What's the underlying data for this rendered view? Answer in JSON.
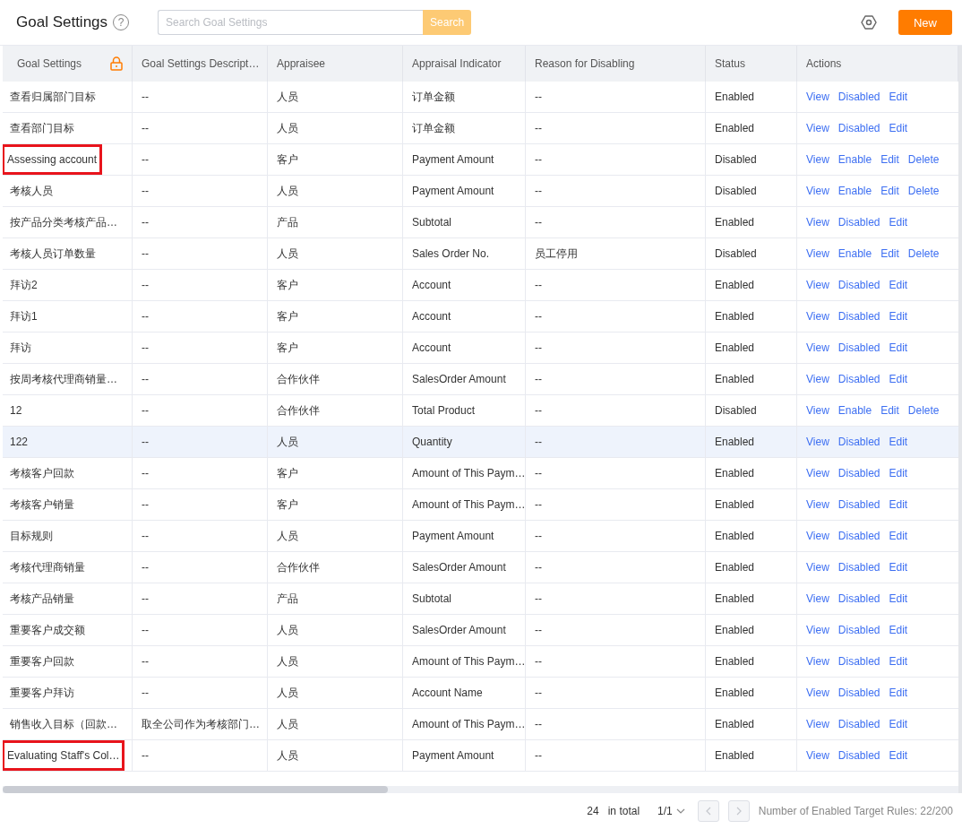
{
  "header": {
    "title": "Goal Settings",
    "help": "?",
    "search": {
      "placeholder": "Search Goal Settings",
      "button": "Search"
    },
    "new_button": "New"
  },
  "table": {
    "columns": [
      {
        "label": "Goal Settings",
        "locked": true
      },
      {
        "label": "Goal Settings Descript…"
      },
      {
        "label": "Appraisee"
      },
      {
        "label": "Appraisal Indicator"
      },
      {
        "label": "Reason for Disabling"
      },
      {
        "label": "Status"
      },
      {
        "label": "Actions"
      }
    ],
    "rows": [
      {
        "cells": [
          "查看归属部门目标",
          "--",
          "人员",
          "订单金额",
          "--",
          "Enabled"
        ],
        "actions": [
          "View",
          "Disabled",
          "Edit"
        ],
        "highlighted": false,
        "hovered": false
      },
      {
        "cells": [
          "查看部门目标",
          "--",
          "人员",
          "订单金额",
          "--",
          "Enabled"
        ],
        "actions": [
          "View",
          "Disabled",
          "Edit"
        ],
        "highlighted": false,
        "hovered": false
      },
      {
        "cells": [
          "Assessing account",
          "--",
          "客户",
          "Payment Amount",
          "--",
          "Disabled"
        ],
        "actions": [
          "View",
          "Enable",
          "Edit",
          "Delete"
        ],
        "highlighted": true,
        "hovered": false
      },
      {
        "cells": [
          "考核人员",
          "--",
          "人员",
          "Payment Amount",
          "--",
          "Disabled"
        ],
        "actions": [
          "View",
          "Enable",
          "Edit",
          "Delete"
        ],
        "highlighted": false,
        "hovered": false
      },
      {
        "cells": [
          "按产品分类考核产品…",
          "--",
          "产品",
          "Subtotal",
          "--",
          "Enabled"
        ],
        "actions": [
          "View",
          "Disabled",
          "Edit"
        ],
        "highlighted": false,
        "hovered": false
      },
      {
        "cells": [
          "考核人员订单数量",
          "--",
          "人员",
          "Sales Order No.",
          "员工停用",
          "Disabled"
        ],
        "actions": [
          "View",
          "Enable",
          "Edit",
          "Delete"
        ],
        "highlighted": false,
        "hovered": false
      },
      {
        "cells": [
          "拜访2",
          "--",
          "客户",
          "Account",
          "--",
          "Enabled"
        ],
        "actions": [
          "View",
          "Disabled",
          "Edit"
        ],
        "highlighted": false,
        "hovered": false
      },
      {
        "cells": [
          "拜访1",
          "--",
          "客户",
          "Account",
          "--",
          "Enabled"
        ],
        "actions": [
          "View",
          "Disabled",
          "Edit"
        ],
        "highlighted": false,
        "hovered": false
      },
      {
        "cells": [
          "拜访",
          "--",
          "客户",
          "Account",
          "--",
          "Enabled"
        ],
        "actions": [
          "View",
          "Disabled",
          "Edit"
        ],
        "highlighted": false,
        "hovered": false
      },
      {
        "cells": [
          "按周考核代理商销量…",
          "--",
          "合作伙伴",
          "SalesOrder Amount",
          "--",
          "Enabled"
        ],
        "actions": [
          "View",
          "Disabled",
          "Edit"
        ],
        "highlighted": false,
        "hovered": false
      },
      {
        "cells": [
          "12",
          "--",
          "合作伙伴",
          "Total Product",
          "--",
          "Disabled"
        ],
        "actions": [
          "View",
          "Enable",
          "Edit",
          "Delete"
        ],
        "highlighted": false,
        "hovered": false
      },
      {
        "cells": [
          "122",
          "--",
          "人员",
          "Quantity",
          "--",
          "Enabled"
        ],
        "actions": [
          "View",
          "Disabled",
          "Edit"
        ],
        "highlighted": false,
        "hovered": true
      },
      {
        "cells": [
          "考核客户回款",
          "--",
          "客户",
          "Amount of This Paym…",
          "--",
          "Enabled"
        ],
        "actions": [
          "View",
          "Disabled",
          "Edit"
        ],
        "highlighted": false,
        "hovered": false
      },
      {
        "cells": [
          "考核客户销量",
          "--",
          "客户",
          "Amount of This Paym…",
          "--",
          "Enabled"
        ],
        "actions": [
          "View",
          "Disabled",
          "Edit"
        ],
        "highlighted": false,
        "hovered": false
      },
      {
        "cells": [
          "目标规则",
          "--",
          "人员",
          "Payment Amount",
          "--",
          "Enabled"
        ],
        "actions": [
          "View",
          "Disabled",
          "Edit"
        ],
        "highlighted": false,
        "hovered": false
      },
      {
        "cells": [
          "考核代理商销量",
          "--",
          "合作伙伴",
          "SalesOrder Amount",
          "--",
          "Enabled"
        ],
        "actions": [
          "View",
          "Disabled",
          "Edit"
        ],
        "highlighted": false,
        "hovered": false
      },
      {
        "cells": [
          "考核产品销量",
          "--",
          "产品",
          "Subtotal",
          "--",
          "Enabled"
        ],
        "actions": [
          "View",
          "Disabled",
          "Edit"
        ],
        "highlighted": false,
        "hovered": false
      },
      {
        "cells": [
          "重要客户成交额",
          "--",
          "人员",
          "SalesOrder Amount",
          "--",
          "Enabled"
        ],
        "actions": [
          "View",
          "Disabled",
          "Edit"
        ],
        "highlighted": false,
        "hovered": false
      },
      {
        "cells": [
          "重要客户回款",
          "--",
          "人员",
          "Amount of This Paym…",
          "--",
          "Enabled"
        ],
        "actions": [
          "View",
          "Disabled",
          "Edit"
        ],
        "highlighted": false,
        "hovered": false
      },
      {
        "cells": [
          "重要客户拜访",
          "--",
          "人员",
          "Account Name",
          "--",
          "Enabled"
        ],
        "actions": [
          "View",
          "Disabled",
          "Edit"
        ],
        "highlighted": false,
        "hovered": false
      },
      {
        "cells": [
          "销售收入目标（回款…",
          "取全公司作为考核部门…",
          "人员",
          "Amount of This Paym…",
          "--",
          "Enabled"
        ],
        "actions": [
          "View",
          "Disabled",
          "Edit"
        ],
        "highlighted": false,
        "hovered": false
      },
      {
        "cells": [
          "Evaluating Staff's Col…",
          "--",
          "人员",
          "Payment Amount",
          "--",
          "Enabled"
        ],
        "actions": [
          "View",
          "Disabled",
          "Edit"
        ],
        "highlighted": true,
        "hovered": false
      }
    ]
  },
  "pagination": {
    "total": "24",
    "total_label": "in total",
    "page": "1/1",
    "prev_disabled": true,
    "next_disabled": true,
    "summary": "Number of Enabled Target Rules: 22/200"
  }
}
